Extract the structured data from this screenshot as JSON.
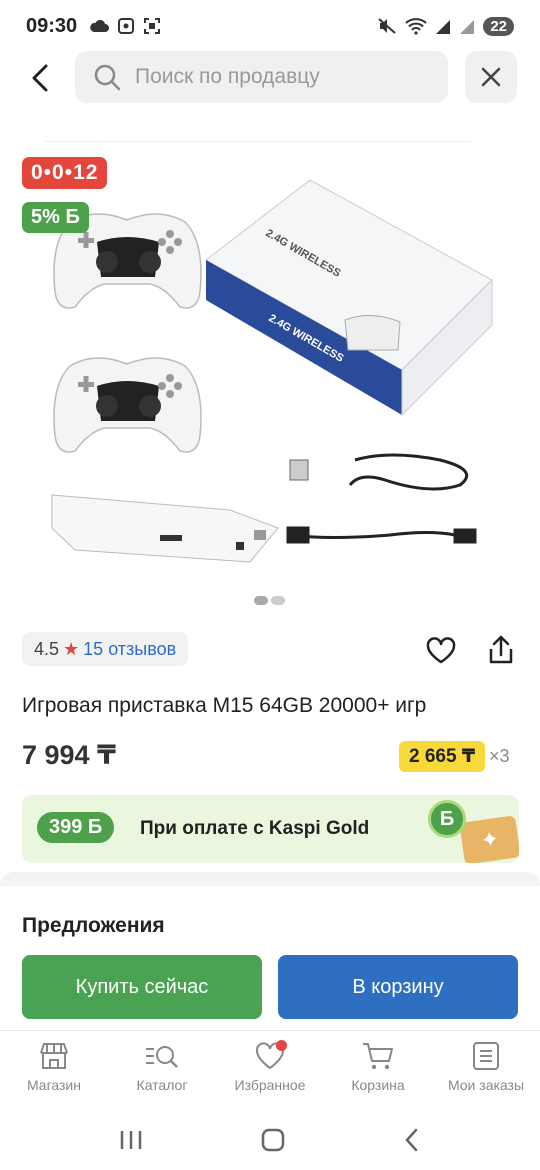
{
  "status_bar": {
    "time": "09:30",
    "battery": "22",
    "icons": [
      "cloud-icon",
      "screenshot-icon",
      "mute-icon",
      "wifi-icon",
      "signal-icon"
    ]
  },
  "header": {
    "search_placeholder": "Поиск по продавцу",
    "back_icon": "back-arrow-icon",
    "close_icon": "close-icon"
  },
  "product": {
    "timer_badge": "0•0•12",
    "bonus_badge": "5% Б",
    "rating": "4.5",
    "reviews": "15 отзывов",
    "title": "Игровая приставка M15 64GB 20000+ игр",
    "price": "7 994 ₸",
    "installment_price": "2 665 ₸",
    "installment_multiplier": "×3",
    "image_pages": 2,
    "active_image_page": 1
  },
  "kaspi_gold": {
    "bonus": "399 Б",
    "text": "При оплате с Kaspi Gold",
    "coin_label": "Б"
  },
  "offers": {
    "title": "Предложения",
    "buy_now": "Купить сейчас",
    "add_to_cart": "В корзину"
  },
  "bottom_nav": {
    "items": [
      {
        "label": "Магазин",
        "icon": "store-icon"
      },
      {
        "label": "Каталог",
        "icon": "catalog-icon"
      },
      {
        "label": "Избранное",
        "icon": "heart-icon"
      },
      {
        "label": "Корзина",
        "icon": "cart-icon"
      },
      {
        "label": "Мои заказы",
        "icon": "orders-icon"
      }
    ]
  },
  "colors": {
    "red": "#e5463b",
    "green": "#4da14a",
    "blue": "#2e6fc2",
    "yellow": "#f8d93a",
    "link": "#2d6bc5"
  }
}
